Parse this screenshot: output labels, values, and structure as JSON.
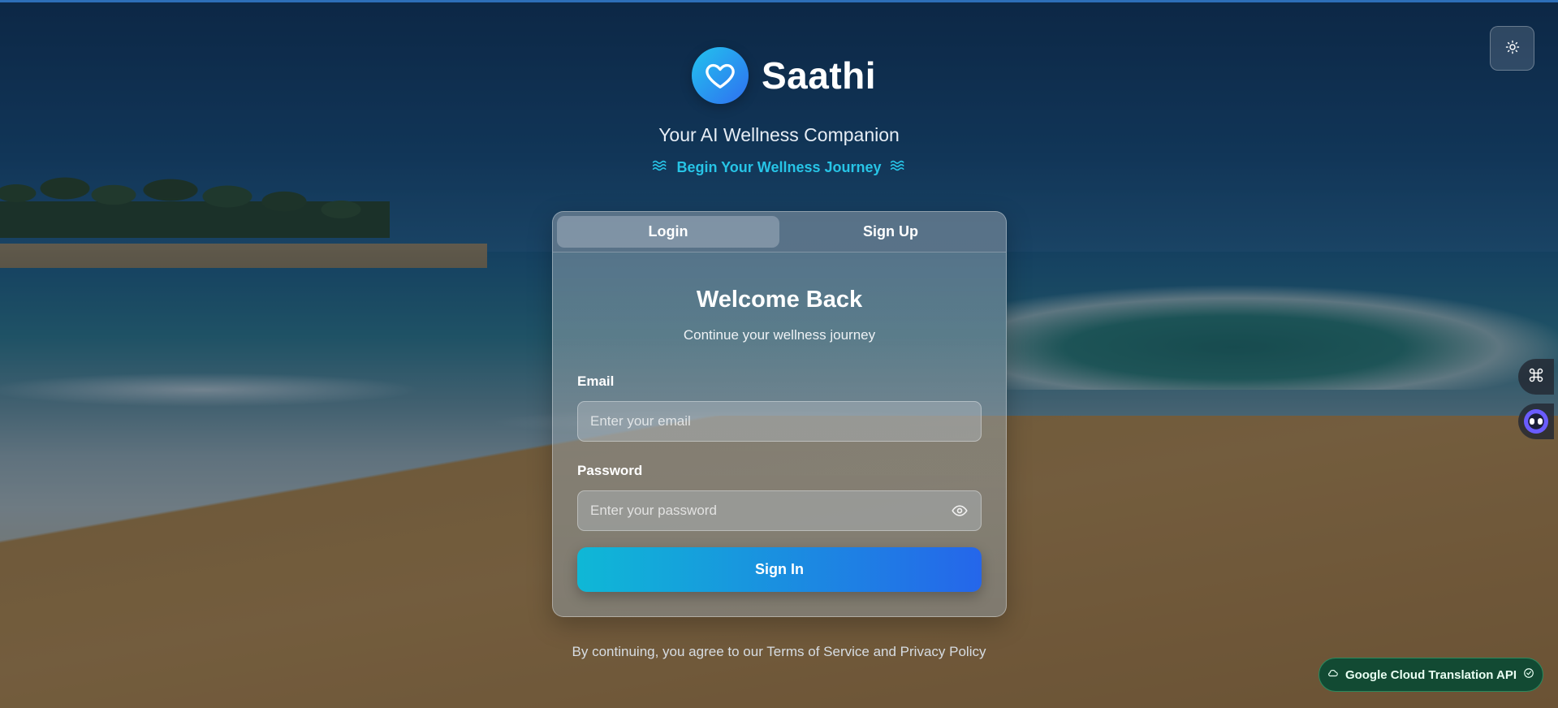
{
  "app": {
    "name": "Saathi",
    "tagline": "Your AI Wellness Companion",
    "journey": "Begin Your Wellness Journey"
  },
  "tabs": [
    {
      "label": "Login",
      "active": true
    },
    {
      "label": "Sign Up",
      "active": false
    }
  ],
  "form": {
    "title": "Welcome Back",
    "subtitle": "Continue your wellness journey",
    "email_label": "Email",
    "email_placeholder": "Enter your email",
    "password_label": "Password",
    "password_placeholder": "Enter your password",
    "submit_label": "Sign In"
  },
  "terms": "By continuing, you agree to our Terms of Service and Privacy Policy",
  "badge": {
    "label": "Google Cloud Translation API"
  },
  "icons": {
    "theme": "sun-icon",
    "logo": "heart-icon",
    "journey": "waves-icon",
    "password_toggle": "eye-icon",
    "side_grid": "command-icon",
    "side_bot": "bot-icon",
    "badge_cloud": "cloud-icon",
    "badge_check": "check-circle-icon"
  },
  "colors": {
    "accent": "#27c4e6",
    "button_start": "#0fb8d6",
    "button_end": "#2566ea",
    "badge_bg": "#124a33"
  }
}
